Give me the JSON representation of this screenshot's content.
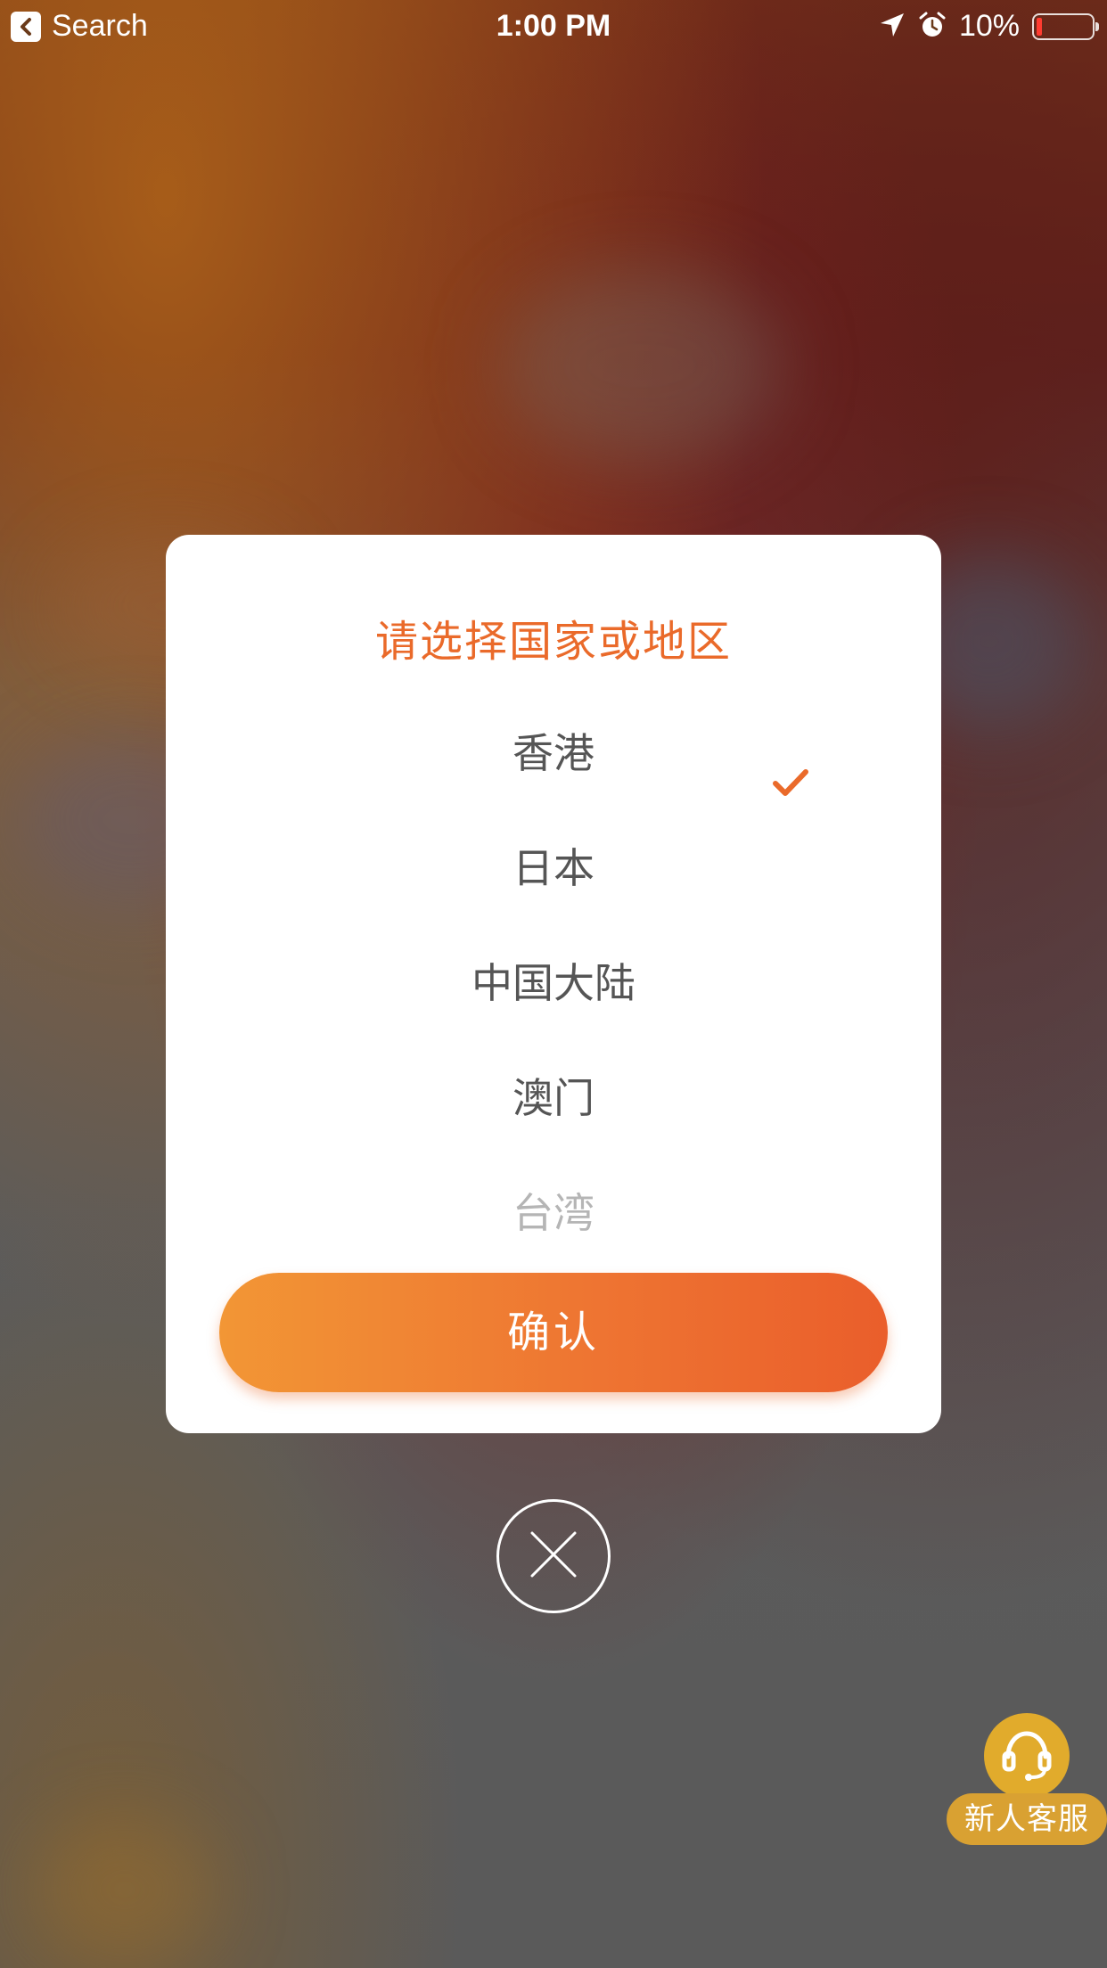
{
  "status_bar": {
    "back_label": "Search",
    "time": "1:00 PM",
    "battery_percent": "10%",
    "battery_level": 0.1,
    "icons": [
      "location-arrow-icon",
      "alarm-icon",
      "battery-icon"
    ]
  },
  "dialog": {
    "title": "请选择国家或地区",
    "options": [
      {
        "label": "香港",
        "selected": true
      },
      {
        "label": "日本",
        "selected": false
      },
      {
        "label": "中国大陆",
        "selected": false
      },
      {
        "label": "澳门",
        "selected": false
      },
      {
        "label": "台湾",
        "selected": false
      }
    ],
    "confirm_label": "确认"
  },
  "close_icon": "close-icon",
  "service": {
    "label": "新人客服",
    "icon": "headset-icon"
  },
  "colors": {
    "accent": "#ea6a2a",
    "button_gradient_start": "#f29635",
    "button_gradient_end": "#ea5e2b",
    "service_badge": "#d9a132"
  }
}
